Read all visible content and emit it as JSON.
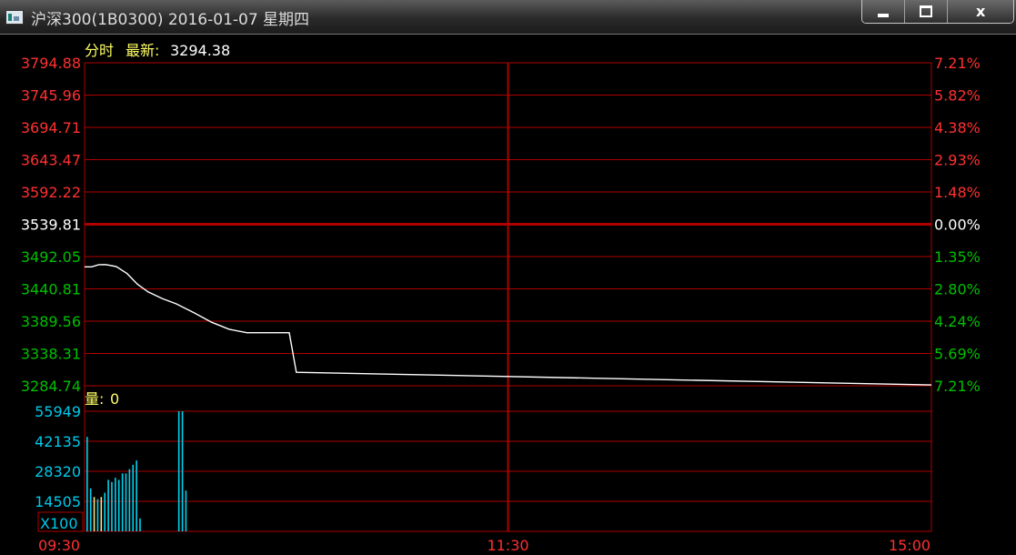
{
  "window": {
    "title": "沪深300(1B0300) 2016-01-07 星期四",
    "icon": "chart-app-icon",
    "minimize_icon": "minimize-icon",
    "maximize_icon": "maximize-icon",
    "close_icon": "close-icon",
    "close_label": "x"
  },
  "colors": {
    "background": "#000000",
    "grid": "#b00000",
    "price_line": "#ffffff",
    "up": "#ff3030",
    "down": "#00c000",
    "neutral": "#ffffff",
    "volume_axis": "#00c8e8",
    "volume_bar": "#00d2f0",
    "volume_bar_alt": "#f0e68c",
    "caption": "#ffff66"
  },
  "price_panel": {
    "mode_label": "分时",
    "latest_label": "最新:",
    "latest_value": "3294.38"
  },
  "volume_panel": {
    "label": "量:",
    "value": "0",
    "multiplier": "X100"
  },
  "chart_data": [
    {
      "type": "line",
      "y_ticks": [
        "3794.88",
        "3745.96",
        "3694.71",
        "3643.47",
        "3592.22",
        "3539.81",
        "3492.05",
        "3440.81",
        "3389.56",
        "3338.31",
        "3284.74"
      ],
      "y_right_ticks": [
        "7.21%",
        "5.82%",
        "4.38%",
        "2.93%",
        "1.48%",
        "0.00%",
        "1.35%",
        "2.80%",
        "4.24%",
        "5.69%",
        "7.21%"
      ],
      "ylim": [
        3284.74,
        3794.88
      ],
      "baseline": 3539.81,
      "x_ticks": [
        "09:30",
        "11:30",
        "15:00"
      ],
      "x": [
        0,
        2,
        4,
        6,
        9,
        12,
        15,
        18,
        22,
        26,
        31,
        36,
        41,
        46,
        50,
        52,
        54,
        56,
        58,
        60,
        240
      ],
      "series": [
        {
          "values": [
            3472.5,
            3472.5,
            3476.0,
            3476.2,
            3473.0,
            3462.0,
            3445.0,
            3433.0,
            3422.5,
            3414.0,
            3400.0,
            3385.0,
            3374.0,
            3368.5,
            3368.5,
            3368.5,
            3368.5,
            3368.5,
            3368.5,
            3306.0,
            3286.0
          ]
        }
      ]
    },
    {
      "type": "bar",
      "y_ticks": [
        "55949",
        "42135",
        "28320",
        "14505"
      ],
      "ylim": [
        0,
        55949
      ],
      "x": [
        0,
        1,
        2,
        3,
        4,
        5,
        6,
        7,
        8,
        9,
        10,
        11,
        12,
        13,
        14,
        15,
        26,
        27,
        28
      ],
      "values": [
        44000,
        20000,
        16000,
        15000,
        16000,
        18000,
        24000,
        23000,
        25000,
        24000,
        27000,
        27000,
        29000,
        31000,
        33000,
        6000,
        55949,
        55949,
        19000
      ]
    }
  ]
}
